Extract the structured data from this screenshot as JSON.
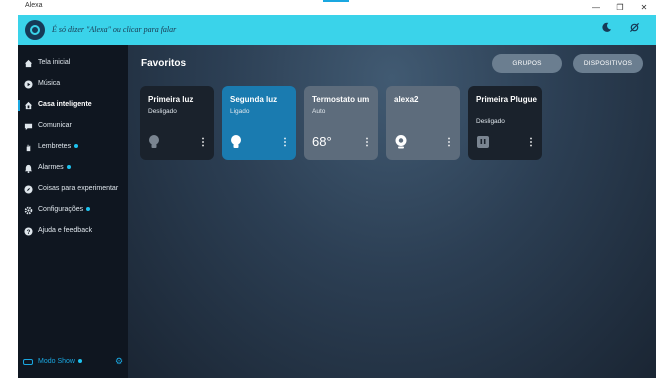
{
  "window": {
    "title": "Alexa",
    "minimize": "—",
    "maximize": "❐",
    "close": "✕"
  },
  "topbar": {
    "hint": "É só dizer \"Alexa\" ou clicar para falar",
    "do_not_disturb_icon": "moon",
    "mic_off_icon": "mic-off"
  },
  "sidebar": {
    "items": [
      {
        "label": "Tela inicial",
        "icon": "home"
      },
      {
        "label": "Música",
        "icon": "play"
      },
      {
        "label": "Casa inteligente",
        "icon": "house-plug",
        "active": true
      },
      {
        "label": "Comunicar",
        "icon": "chat"
      },
      {
        "label": "Lembretes",
        "icon": "hand",
        "badge": true
      },
      {
        "label": "Alarmes",
        "icon": "bell",
        "badge": true
      },
      {
        "label": "Coisas para experimentar",
        "icon": "compass"
      },
      {
        "label": "Configurações",
        "icon": "gear",
        "badge": true
      },
      {
        "label": "Ajuda e feedback",
        "icon": "help"
      }
    ],
    "modo_show": {
      "label": "Modo Show",
      "badge": true
    }
  },
  "main": {
    "title": "Favoritos",
    "buttons": {
      "grupos": "GRUPOS",
      "dispositivos": "DISPOSITIVOS"
    },
    "cards": [
      {
        "name": "Primeira luz",
        "status": "Desligado",
        "device": "bulb",
        "bg": "#1a222c",
        "icon_color": "#7a8591"
      },
      {
        "name": "Segunda luz",
        "status": "Ligado",
        "device": "bulb",
        "bg": "#1a7bb0",
        "icon_color": "#ffffff"
      },
      {
        "name": "Termostato um",
        "status": "Auto",
        "temperature": "68°",
        "bg": "#5d6c7c"
      },
      {
        "name": "alexa2",
        "status": "",
        "device": "camera",
        "bg": "#5d6c7c",
        "icon_color": "#ffffff"
      },
      {
        "name": "Primeira Plugue",
        "status": "Desligado",
        "device": "plug",
        "bg": "#1a222c",
        "icon_color": "#7a8591"
      }
    ]
  },
  "colors": {
    "accent": "#3ad3ea",
    "link": "#1aa7e0",
    "sidebar_bg": "#0f1620"
  }
}
